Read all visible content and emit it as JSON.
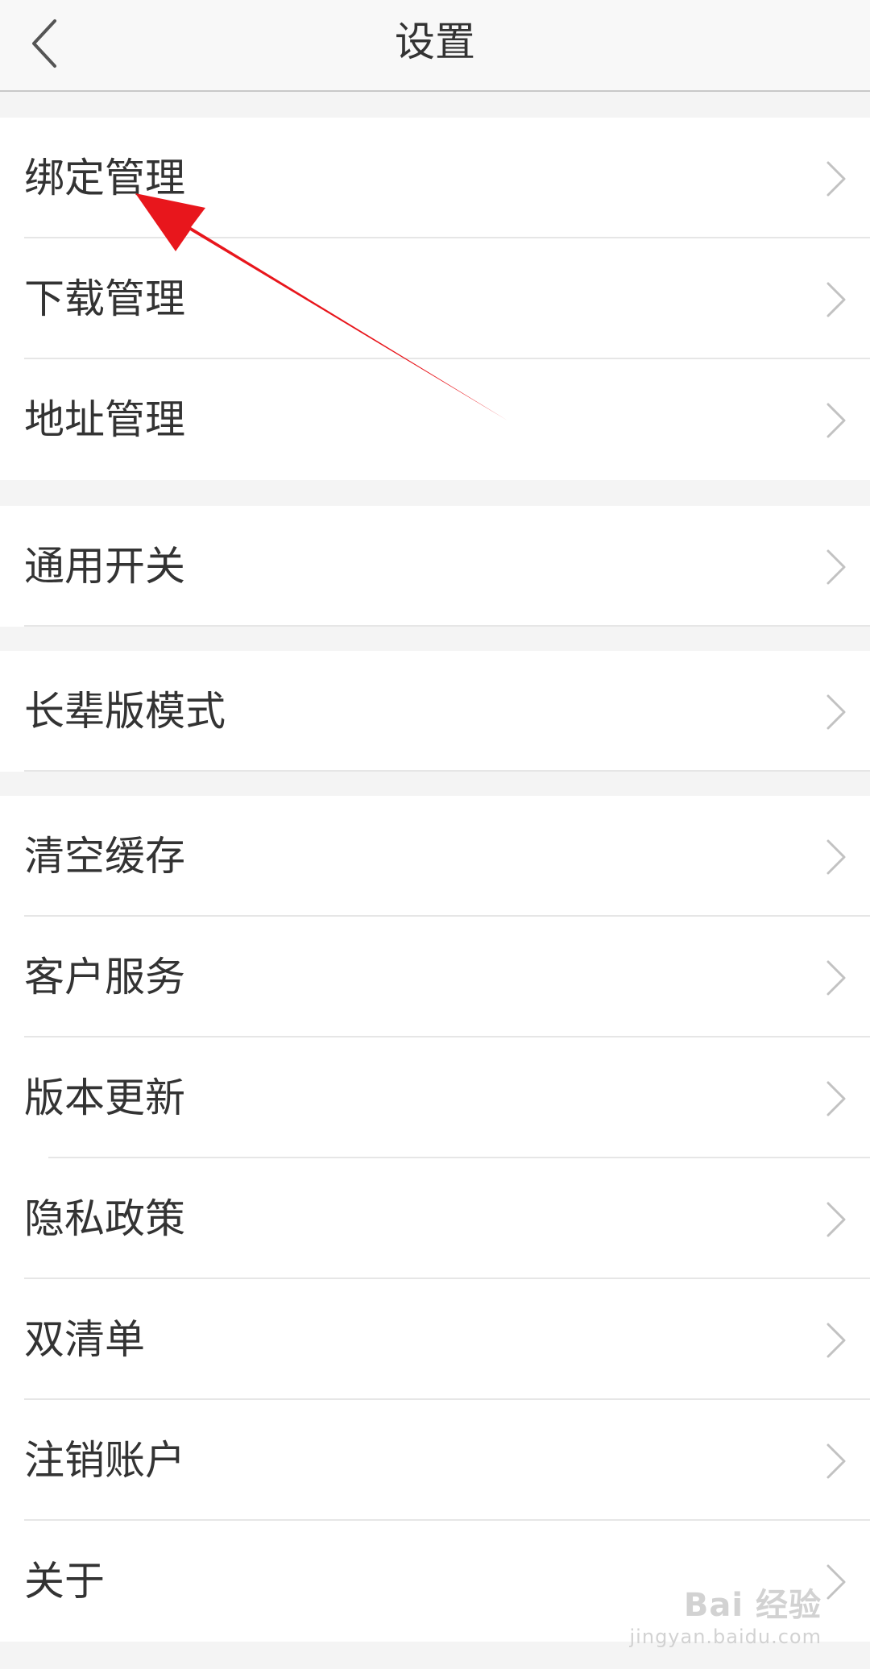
{
  "header": {
    "title": "设置"
  },
  "groups": [
    {
      "items": [
        {
          "label": "绑定管理"
        },
        {
          "label": "下载管理"
        },
        {
          "label": "地址管理"
        }
      ]
    },
    {
      "items": [
        {
          "label": "通用开关"
        }
      ]
    },
    {
      "items": [
        {
          "label": "长辈版模式"
        }
      ]
    },
    {
      "items": [
        {
          "label": "清空缓存"
        },
        {
          "label": "客户服务"
        },
        {
          "label": "版本更新"
        },
        {
          "label": "隐私政策"
        },
        {
          "label": "双清单"
        },
        {
          "label": "注销账户"
        },
        {
          "label": "关于"
        }
      ]
    }
  ],
  "annotation": {
    "color": "#e8161c"
  },
  "watermark": {
    "text": "Bai 经验",
    "url": "jingyan.baidu.com"
  },
  "icons": {
    "back": "chevron-left-icon",
    "row": "chevron-right-icon"
  }
}
